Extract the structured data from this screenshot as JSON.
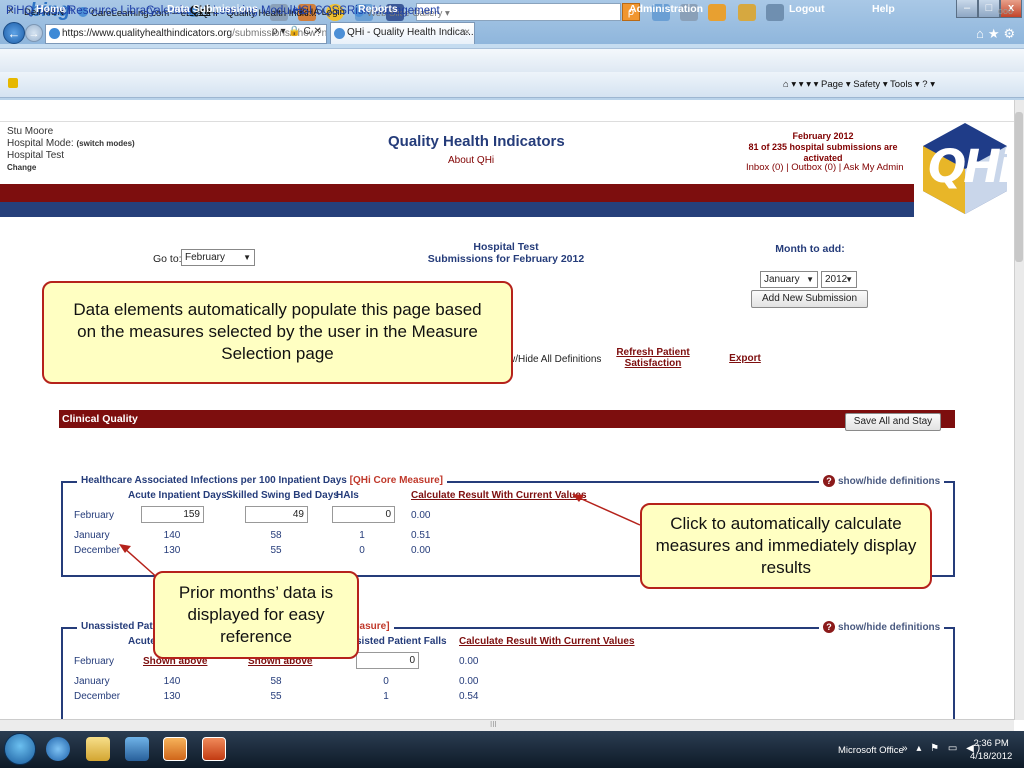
{
  "browser": {
    "url_host": "https://www.qualityhealthindicators.org",
    "url_path": "/submissions/show?n",
    "addr_controls": "ρ ▾ 🔒 C ✕",
    "tab_title": "QHi - Quality Health Indica...",
    "tab_close": "×",
    "back_glyph": "←",
    "forward_glyph": "→",
    "window_min": "–",
    "window_max": "□",
    "window_close": "x",
    "home_icons": "⌂★⚙",
    "bing_close": "x",
    "bing_logo": "bing",
    "bing_search_glyph": "ρ",
    "bing_more": "ooo",
    "favorites": [
      "Dell MSN",
      "CareLearning.com -- eLea...",
      "QHI - Quality Health Indic...",
      "KHA Login",
      "Web Slice Gallery ▾"
    ],
    "command_bar": "⌂ ▾  ▾  ▾  ▾  Page ▾  Safety ▾  Tools ▾  ? ▾"
  },
  "site_links": [
    "PiHQ Search",
    "Resource Library",
    "Calendar",
    "QHi",
    "Learning Modules",
    "HSI",
    "SQSS",
    "Risk Management"
  ],
  "header": {
    "user_name": "Stu Moore",
    "hospital_mode_label": "Hospital Mode:",
    "switch_modes": "(switch modes)",
    "hospital_name": "Hospital Test",
    "change_link": "Change",
    "app_title": "Quality Health Indicators",
    "about_link": "About QHi",
    "period": "February 2012",
    "activation_status": "81 of 235 hospital submissions are activated",
    "mini_links": "Inbox (0) | Outbox (0) | Ask My Admin",
    "logo_text": "QHi"
  },
  "main_nav": [
    "Home",
    "Data Submissions",
    "Reports",
    "My Profile",
    "Administration",
    "Logout",
    "Help"
  ],
  "controls": {
    "goto_label": "Go to:",
    "goto_value": "February",
    "center_title_1": "Hospital Test",
    "center_title_2": "Submissions for February 2012",
    "month_to_add_label": "Month to add:",
    "month_value": "January",
    "year_value": "2012",
    "add_button": "Add New Submission",
    "show_hide_all": "w/Hide All Definitions",
    "refresh_link": "Refresh Patient Satisfaction",
    "export_link": "Export",
    "save_button": "Save All and Stay"
  },
  "section_title": "Clinical Quality",
  "hai_measure": {
    "title": "Healthcare Associated Infections per 100 Inpatient Days",
    "core_tag": "[QHi Core Measure]",
    "columns": [
      "Acute Inpatient Days",
      "Skilled Swing Bed Days",
      "HAIs"
    ],
    "calc_link": "Calculate Result With Current Values",
    "defs_link": "show/hide definitions",
    "rows": [
      {
        "month": "February",
        "values": [
          "159",
          "49",
          "0"
        ],
        "result": "0.00"
      },
      {
        "month": "January",
        "values": [
          "140",
          "58",
          "1"
        ],
        "result": "0.51"
      },
      {
        "month": "December",
        "values": [
          "130",
          "55",
          "0"
        ],
        "result": "0.00"
      }
    ]
  },
  "falls_measure": {
    "title_start": "Unassisted Pati",
    "title_end": "easure]",
    "col_start": "Acute",
    "col_falls": "sisted Patient Falls",
    "calc_link": "Calculate Result With Current Values",
    "defs_link": "show/hide definitions",
    "shown_above": "Shown above",
    "rows": [
      {
        "month": "February",
        "values": [
          "",
          "",
          "0"
        ],
        "result": "0.00"
      },
      {
        "month": "January",
        "values": [
          "140",
          "58",
          "0"
        ],
        "result": "0.00"
      },
      {
        "month": "December",
        "values": [
          "130",
          "55",
          "1"
        ],
        "result": "0.54"
      }
    ]
  },
  "callouts": {
    "data_elements": "Data elements automatically populate this page based on the measures selected by the user in the Measure Selection page",
    "calculate": "Click to automatically calculate measures and immediately display results",
    "prior_months": "Prior months’ data is displayed for easy reference"
  },
  "scroll_grip": "III",
  "taskbar": {
    "tray_label": "Microsoft Office",
    "tray_icons": "» ▴ ⚑ ▭ ◀)",
    "time": "2:36 PM",
    "date": "4/18/2012"
  }
}
